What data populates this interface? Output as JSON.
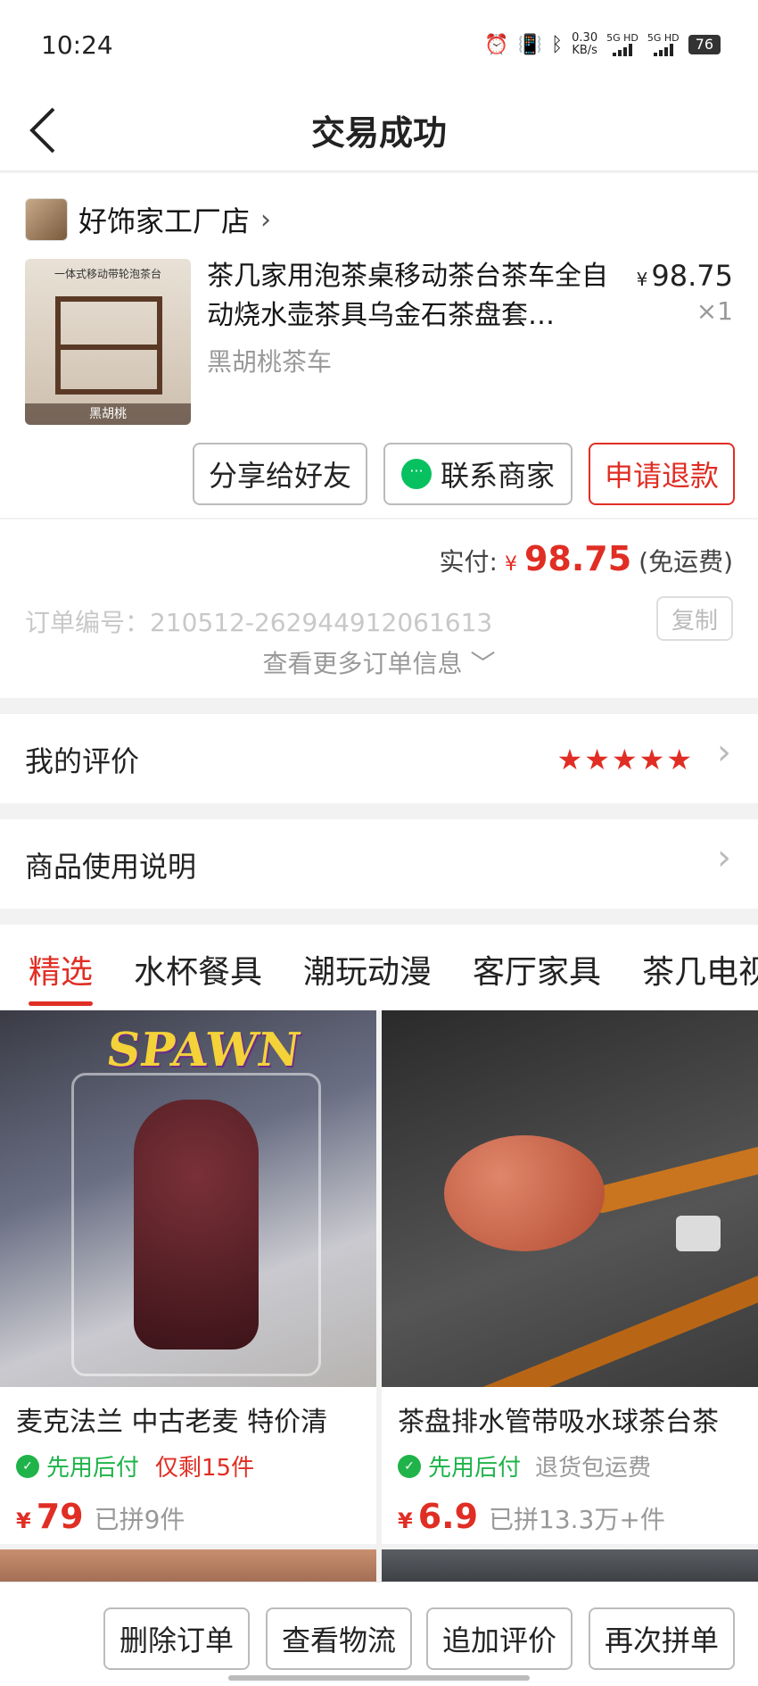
{
  "status": {
    "time": "10:24",
    "net_speed_value": "0.30",
    "net_speed_unit": "KB/s",
    "sim1": "5G HD",
    "sim2": "5G HD",
    "battery": "76"
  },
  "header": {
    "title": "交易成功",
    "back_icon": "back-arrow-icon"
  },
  "order_item": {
    "shop_name": "好饰家工厂店",
    "product_title": "茶几家用泡茶桌移动茶台茶车全自动烧水壶茶具乌金石茶盘套…",
    "spec": "黑胡桃茶车",
    "price_symbol": "¥",
    "price": "98.75",
    "quantity": "×1",
    "image_caption": "黑胡桃",
    "image_top_text": "一体式移动带轮泡茶台",
    "buttons": {
      "share": "分享给好友",
      "contact": "联系商家",
      "refund": "申请退款"
    }
  },
  "payment": {
    "label": "实付:",
    "symbol": "¥",
    "amount": "98.75",
    "note": "(免运费)",
    "order_number": "订单编号：210512-262944912061613",
    "copy_label": "复制",
    "more_info": "查看更多订单信息"
  },
  "review": {
    "label": "我的评价",
    "stars": 5,
    "stars_text": "★★★★★"
  },
  "manual": {
    "label": "商品使用说明"
  },
  "tabs": [
    "精选",
    "水杯餐具",
    "潮玩动漫",
    "客厅家具",
    "茶几电视"
  ],
  "products": [
    {
      "title": "麦克法兰 中古老麦 特价清",
      "tag": "先用后付",
      "extra": "仅剩15件",
      "price_symbol": "¥",
      "price": "79",
      "sold": "已拼9件",
      "image_text": "SPAWN"
    },
    {
      "title": "茶盘排水管带吸水球茶台茶",
      "tag": "先用后付",
      "extra": "退货包运费",
      "price_symbol": "¥",
      "price": "6.9",
      "sold": "已拼13.3万+件"
    }
  ],
  "bottom_actions": [
    "删除订单",
    "查看物流",
    "追加评价",
    "再次拼单"
  ],
  "colors": {
    "accent": "#e02e24",
    "green": "#1fb34a",
    "wechat": "#07c160"
  }
}
